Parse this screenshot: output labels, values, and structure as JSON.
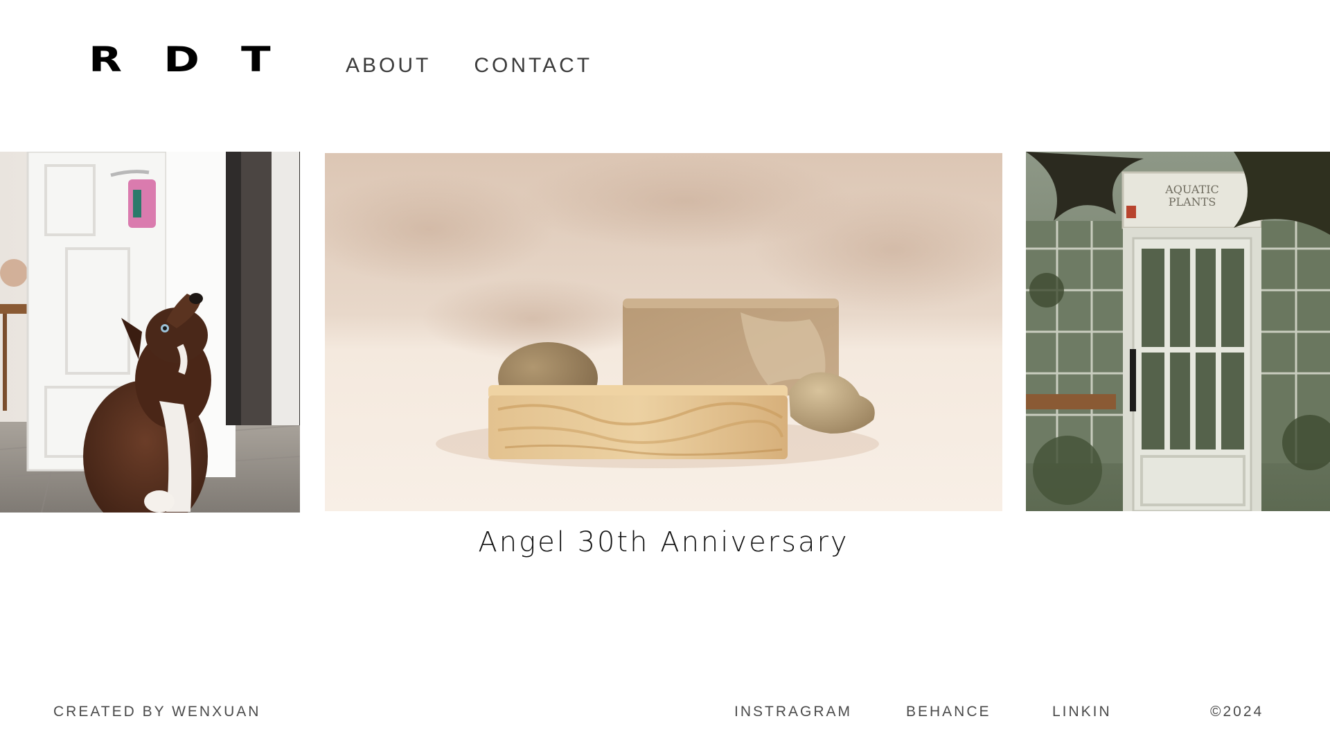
{
  "brand": {
    "letters": [
      "R",
      "D",
      "T"
    ]
  },
  "nav": {
    "items": [
      "ABOUT",
      "CONTACT"
    ]
  },
  "carousel": {
    "slides": [
      {
        "subject": "dog-in-hallway"
      },
      {
        "subject": "stones-and-wood-block-podium"
      },
      {
        "subject": "greenhouse-door",
        "sign_text": [
          "AQUATIC",
          "PLANTS"
        ]
      }
    ],
    "active_caption": "Angel 30th Anniversary"
  },
  "footer": {
    "credit": "CREATED BY WENXUAN",
    "links": [
      "INSTRAGRAM",
      "BEHANCE",
      "LINKIN"
    ],
    "copyright": "©2024"
  },
  "colors": {
    "text": "#111111",
    "nav": "#3a3a3a",
    "footer": "#4a4a4a",
    "background": "#ffffff"
  }
}
